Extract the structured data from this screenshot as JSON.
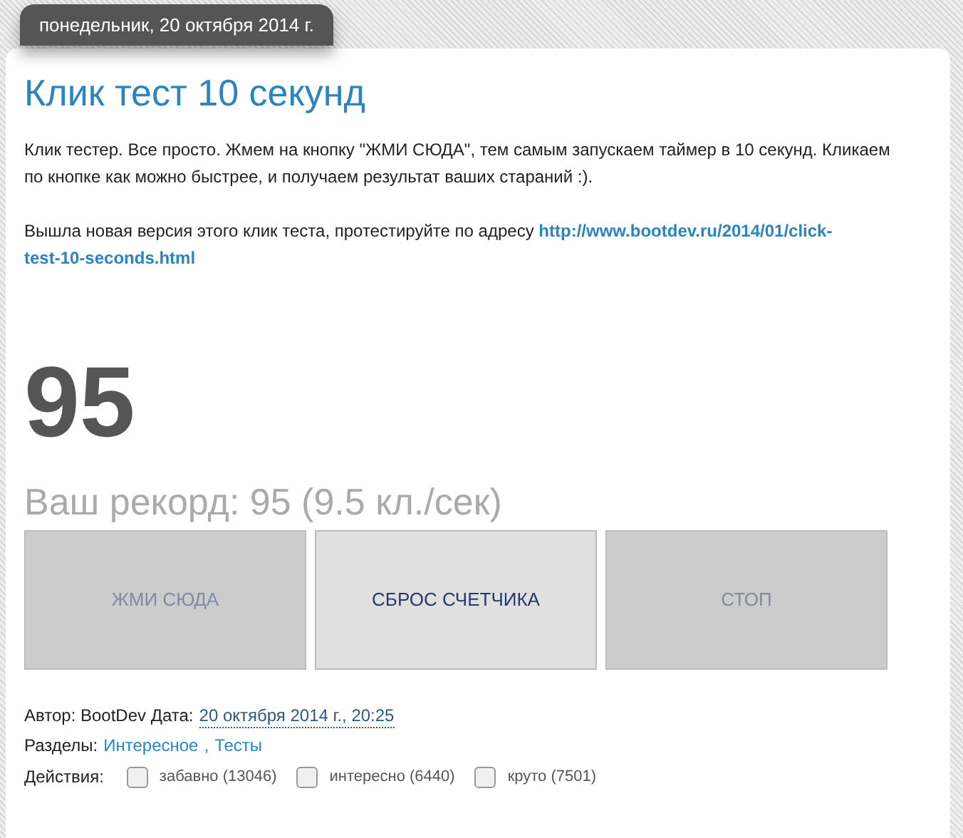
{
  "date_header": "понедельник, 20 октября 2014 г.",
  "post": {
    "title": "Клик тест 10 секунд",
    "intro": "Клик тестер. Все просто. Жмем на кнопку \"ЖМИ СЮДА\", тем самым запускаем таймер в 10 секунд. Кликаем по кнопке как можно быстрее, и получаем результат ваших стараний :).",
    "notice": "Вышла новая версия этого клик теста, протестируйте по адресу",
    "notice_link_lines": [
      "http://www.bootdev.ru/2014/01/click-",
      "test-10-seconds.html"
    ]
  },
  "counter": "95",
  "record": "Ваш рекорд: 95 (9.5 кл./сек)",
  "buttons": [
    {
      "label": "ЖМИ СЮДА",
      "disabled": true
    },
    {
      "label": "СБРОС СЧЕТЧИКА",
      "disabled": false
    },
    {
      "label": "СТОП",
      "disabled": true
    }
  ],
  "meta": {
    "author": "Автор: BootDev Дата:",
    "date_link": "20 октября 2014 г., 20:25",
    "sections_label": "Разделы:",
    "sections": [
      "Интересное",
      "Тесты"
    ],
    "sections_separator": ",",
    "actions_label": "Действия:",
    "reactions": [
      {
        "label": "забавно (13046)",
        "checked": false
      },
      {
        "label": "интересно (6440)",
        "checked": false
      },
      {
        "label": "круто (7501)",
        "checked": false
      }
    ]
  }
}
